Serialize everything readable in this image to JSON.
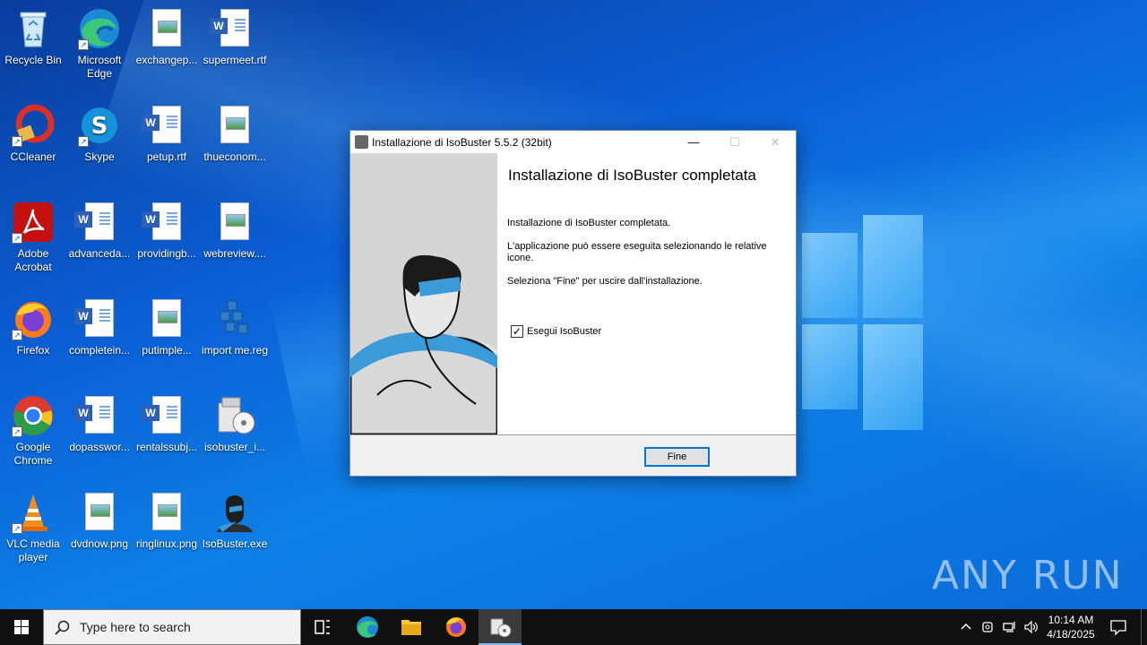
{
  "desktop_icons": [
    {
      "label": "Recycle Bin"
    },
    {
      "label": "Microsoft Edge"
    },
    {
      "label": "exchangep..."
    },
    {
      "label": "supermeet.rtf"
    },
    {
      "label": "CCleaner"
    },
    {
      "label": "Skype"
    },
    {
      "label": "petup.rtf"
    },
    {
      "label": "thueconom..."
    },
    {
      "label": "Adobe Acrobat"
    },
    {
      "label": "advanceda..."
    },
    {
      "label": "providingb..."
    },
    {
      "label": "webreview...."
    },
    {
      "label": "Firefox"
    },
    {
      "label": "completein..."
    },
    {
      "label": "putimple..."
    },
    {
      "label": "import me.reg"
    },
    {
      "label": "Google Chrome"
    },
    {
      "label": "dopasswor..."
    },
    {
      "label": "rentalssubj..."
    },
    {
      "label": "isobuster_i..."
    },
    {
      "label": "VLC media player"
    },
    {
      "label": "dvdnow.png"
    },
    {
      "label": "ringlinux.png"
    },
    {
      "label": "IsoBuster.exe"
    }
  ],
  "dialog": {
    "title": "Installazione di IsoBuster 5.5.2 (32bit)",
    "controls": {
      "minimize": "—",
      "maximize": "☐",
      "close": "✕"
    },
    "heading": "Installazione di IsoBuster completata",
    "para1": "Installazione di IsoBuster completata.",
    "para2": "L'applicazione può essere eseguita selezionando le relative icone.",
    "para3": "Seleziona \"Fine\" per uscire dall'installazione.",
    "checkbox_label": "Esegui IsoBuster",
    "checkbox_checked": true,
    "finish_button": "Fine"
  },
  "watermark": "ANY RUN",
  "taskbar": {
    "search_placeholder": "Type here to search",
    "apps": [
      "task-view",
      "edge",
      "file-explorer",
      "firefox",
      "isobuster-installer"
    ],
    "clock_time": "10:14 AM",
    "clock_date": "4/18/2025"
  }
}
